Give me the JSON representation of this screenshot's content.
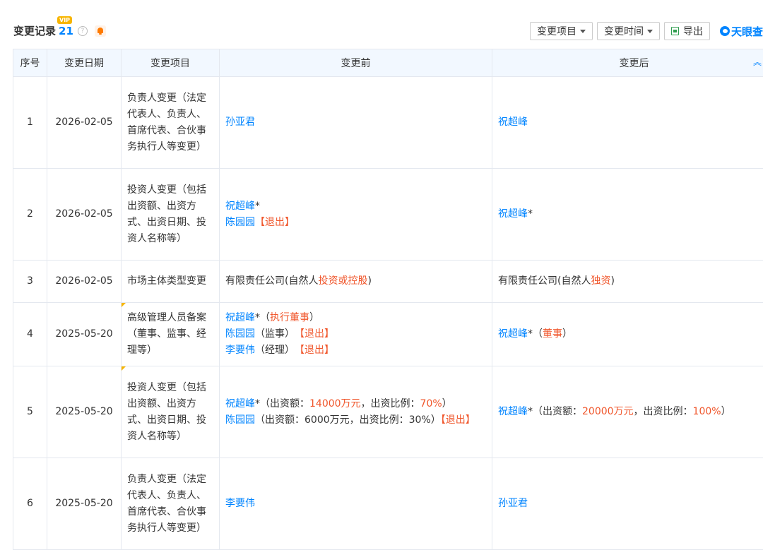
{
  "header": {
    "title": "变更记录",
    "count": "21",
    "vip": "VIP",
    "help": "?",
    "toolbar": {
      "filter_item_label": "变更项目",
      "filter_time_label": "变更时间",
      "export_label": "导出",
      "brand_label": "天眼查"
    }
  },
  "table": {
    "columns": [
      "序号",
      "变更日期",
      "变更项目",
      "变更前",
      "变更后"
    ],
    "rows": [
      {
        "index": "1",
        "date": "2026-02-05",
        "item": "负责人变更（法定代表人、负责人、首席代表、合伙事务执行人等变更）",
        "before": [
          {
            "text": "孙亚君",
            "cls": "link"
          }
        ],
        "after": [
          {
            "text": "祝超峰",
            "cls": "link"
          }
        ]
      },
      {
        "index": "2",
        "date": "2026-02-05",
        "item": "投资人变更（包括出资额、出资方式、出资日期、投资人名称等）",
        "before": [
          {
            "text": "祝超峰",
            "cls": "link"
          },
          {
            "text": "*",
            "cls": ""
          },
          {
            "br": true
          },
          {
            "text": "陈园园",
            "cls": "link"
          },
          {
            "text": "【退出】",
            "cls": "red"
          }
        ],
        "after": [
          {
            "text": "祝超峰",
            "cls": "link"
          },
          {
            "text": "*",
            "cls": ""
          }
        ]
      },
      {
        "index": "3",
        "date": "2026-02-05",
        "item": "市场主体类型变更",
        "before": [
          {
            "text": "有限责任公司(自然人",
            "cls": ""
          },
          {
            "text": "投资或控股",
            "cls": "red"
          },
          {
            "text": ")",
            "cls": ""
          }
        ],
        "after": [
          {
            "text": "有限责任公司(自然人",
            "cls": ""
          },
          {
            "text": "独资",
            "cls": "red"
          },
          {
            "text": ")",
            "cls": ""
          }
        ]
      },
      {
        "index": "4",
        "date": "2025-05-20",
        "flag": true,
        "item": "高级管理人员备案（董事、监事、经理等）",
        "before": [
          {
            "text": "祝超峰",
            "cls": "link"
          },
          {
            "text": "*（",
            "cls": ""
          },
          {
            "text": "执行董事",
            "cls": "red"
          },
          {
            "text": "）",
            "cls": ""
          },
          {
            "br": true
          },
          {
            "text": "陈园园",
            "cls": "link"
          },
          {
            "text": "（监事）　",
            "cls": ""
          },
          {
            "text": "【退出】",
            "cls": "red"
          },
          {
            "br": true
          },
          {
            "text": "李要伟",
            "cls": "link"
          },
          {
            "text": "（经理）　",
            "cls": ""
          },
          {
            "text": "【退出】",
            "cls": "red"
          }
        ],
        "after": [
          {
            "text": "祝超峰",
            "cls": "link"
          },
          {
            "text": "*（",
            "cls": ""
          },
          {
            "text": "董事",
            "cls": "red"
          },
          {
            "text": "）",
            "cls": ""
          }
        ]
      },
      {
        "index": "5",
        "date": "2025-05-20",
        "flag": true,
        "item": "投资人变更（包括出资额、出资方式、出资日期、投资人名称等）",
        "before": [
          {
            "text": "祝超峰",
            "cls": "link"
          },
          {
            "text": "*（出资额：",
            "cls": ""
          },
          {
            "text": "14000万元",
            "cls": "red"
          },
          {
            "text": "，出资比例：",
            "cls": ""
          },
          {
            "text": "70%",
            "cls": "red"
          },
          {
            "text": "）",
            "cls": ""
          },
          {
            "br": true
          },
          {
            "text": "陈园园",
            "cls": "link"
          },
          {
            "text": "（出资额：6000万元，出资比例：30%）",
            "cls": ""
          },
          {
            "text": "【退出】",
            "cls": "red"
          }
        ],
        "after": [
          {
            "text": "祝超峰",
            "cls": "link"
          },
          {
            "text": "*（出资额：",
            "cls": ""
          },
          {
            "text": "20000万元",
            "cls": "red"
          },
          {
            "text": "，出资比例：",
            "cls": ""
          },
          {
            "text": "100%",
            "cls": "red"
          },
          {
            "text": "）",
            "cls": ""
          }
        ]
      },
      {
        "index": "6",
        "date": "2025-05-20",
        "item": "负责人变更（法定代表人、负责人、首席代表、合伙事务执行人等变更）",
        "before": [
          {
            "text": "李要伟",
            "cls": "link"
          }
        ],
        "after": [
          {
            "text": "孙亚君",
            "cls": "link"
          }
        ]
      }
    ]
  }
}
